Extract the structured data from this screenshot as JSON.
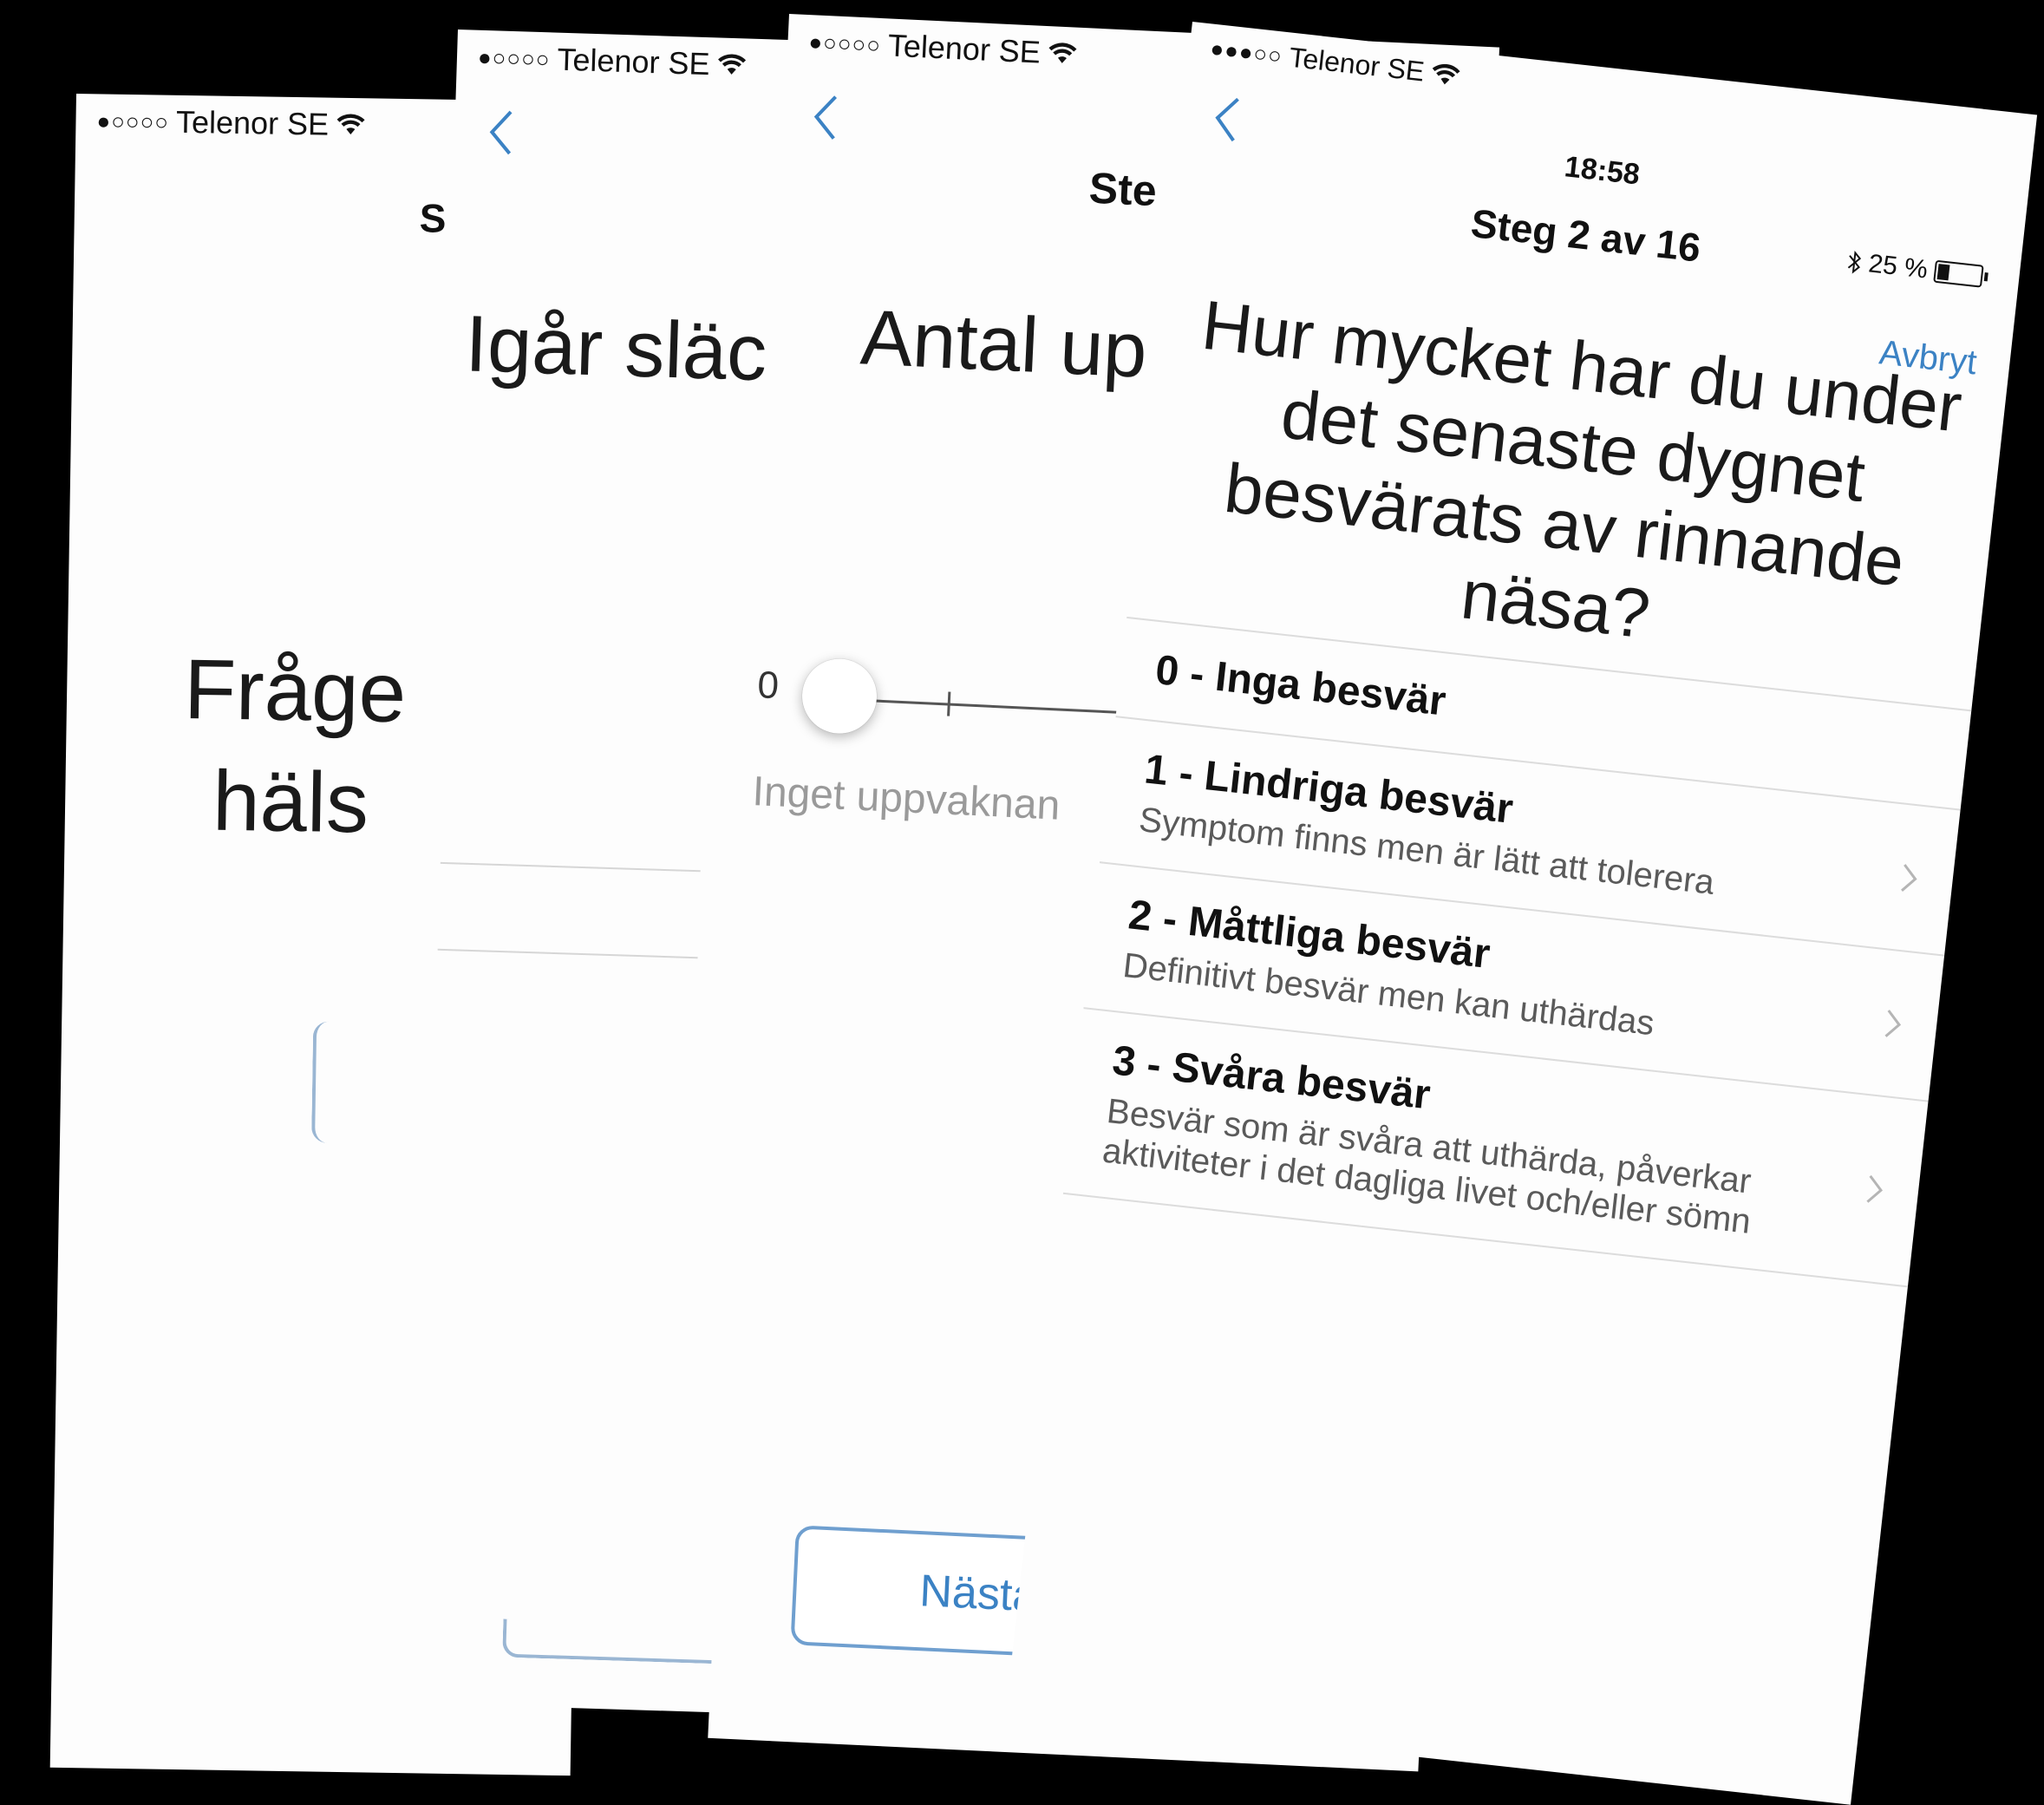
{
  "status_bar": {
    "carrier": "Telenor SE",
    "signal_dots": "●○○○○",
    "signal_dots_4": "●●●○○"
  },
  "screen1": {
    "nav_fragment": "S",
    "big_text": [
      "Fråge",
      "häls"
    ]
  },
  "screen2": {
    "big_text": "Igår släc"
  },
  "screen3": {
    "nav_fragment": "Ste",
    "big_text": "Antal up",
    "slider": {
      "value": 0,
      "value_label": "0",
      "caption": "Inget uppvaknan"
    },
    "next_button": "Nästa"
  },
  "screen4": {
    "time": "18:58",
    "battery": "25 %",
    "battery_level": 0.25,
    "title": "Steg 2 av 16",
    "cancel": "Avbryt",
    "question": "Hur mycket har du under det senaste dygnet besvärats av rinnande näsa?",
    "options": [
      {
        "title": "0 - Inga besvär",
        "desc": ""
      },
      {
        "title": "1 - Lindriga besvär",
        "desc": "Symptom finns men är lätt att tolerera"
      },
      {
        "title": "2 - Måttliga besvär",
        "desc": "Definitivt besvär men kan uthärdas"
      },
      {
        "title": "3 - Svåra besvär",
        "desc": "Besvär som är svåra att uthärda, påverkar aktiviteter i det dagliga livet och/eller sömn"
      }
    ]
  },
  "colors": {
    "accent": "#3b82c4",
    "background": "#000000",
    "screen": "#fdfdfd"
  }
}
